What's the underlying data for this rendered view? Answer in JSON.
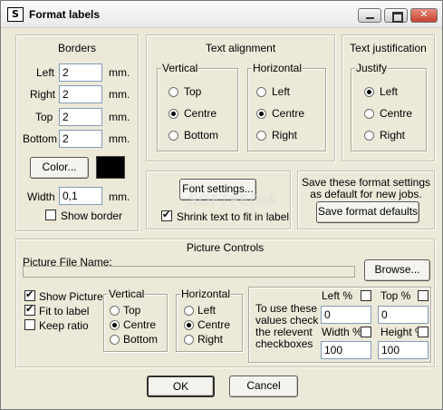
{
  "window": {
    "title": "Format labels",
    "buttons": {
      "minimize": "",
      "maximize": "",
      "close": "✕"
    }
  },
  "borders": {
    "title": "Borders",
    "fields": [
      {
        "label": "Left",
        "value": "2",
        "unit": "mm."
      },
      {
        "label": "Right",
        "value": "2",
        "unit": "mm."
      },
      {
        "label": "Top",
        "value": "2",
        "unit": "mm."
      },
      {
        "label": "Bottom",
        "value": "2",
        "unit": "mm."
      }
    ],
    "color_button": "Color...",
    "color_value": "#000000",
    "width_label": "Width",
    "width_value": "0,1",
    "width_unit": "mm.",
    "show_border_label": "Show border",
    "show_border_checked": false
  },
  "text_alignment": {
    "title": "Text alignment",
    "vertical": {
      "label": "Vertical",
      "options": [
        "Top",
        "Centre",
        "Bottom"
      ],
      "selected": "Centre"
    },
    "horizontal": {
      "label": "Horizontal",
      "options": [
        "Left",
        "Centre",
        "Right"
      ],
      "selected": "Centre"
    }
  },
  "text_justification": {
    "title": "Text justification",
    "justify": {
      "label": "Justify",
      "options": [
        "Left",
        "Centre",
        "Right"
      ],
      "selected": "Left"
    }
  },
  "font": {
    "font_settings_button": "Font settings...",
    "shrink_label": "Shrink text to fit in label",
    "shrink_checked": true
  },
  "save_defaults": {
    "text_line1": "Save these format settings",
    "text_line2": "as default for new jobs.",
    "button": "Save format defaults"
  },
  "watermark": "SOFTPEDIA",
  "picture": {
    "title": "Picture Controls",
    "file_label": "Picture File Name:",
    "file_value": "",
    "browse_button": "Browse...",
    "checkboxes": [
      {
        "label": "Show Picture",
        "checked": true
      },
      {
        "label": "Fit to label",
        "checked": true
      },
      {
        "label": "Keep ratio",
        "checked": false
      }
    ],
    "vertical": {
      "label": "Vertical",
      "options": [
        "Top",
        "Centre",
        "Bottom"
      ],
      "selected": "Centre"
    },
    "horizontal": {
      "label": "Horizontal",
      "options": [
        "Left",
        "Centre",
        "Right"
      ],
      "selected": "Centre"
    },
    "help_lines": [
      "To use these",
      "values check",
      "the relevent",
      "checkboxes"
    ],
    "left_pct": {
      "label": "Left %",
      "value": "0",
      "checked": false
    },
    "top_pct": {
      "label": "Top %",
      "value": "0",
      "checked": false
    },
    "width_pct": {
      "label": "Width %",
      "value": "100",
      "checked": false
    },
    "height_pct": {
      "label": "Height %",
      "value": "100",
      "checked": false
    }
  },
  "footer": {
    "ok": "OK",
    "cancel": "Cancel"
  }
}
